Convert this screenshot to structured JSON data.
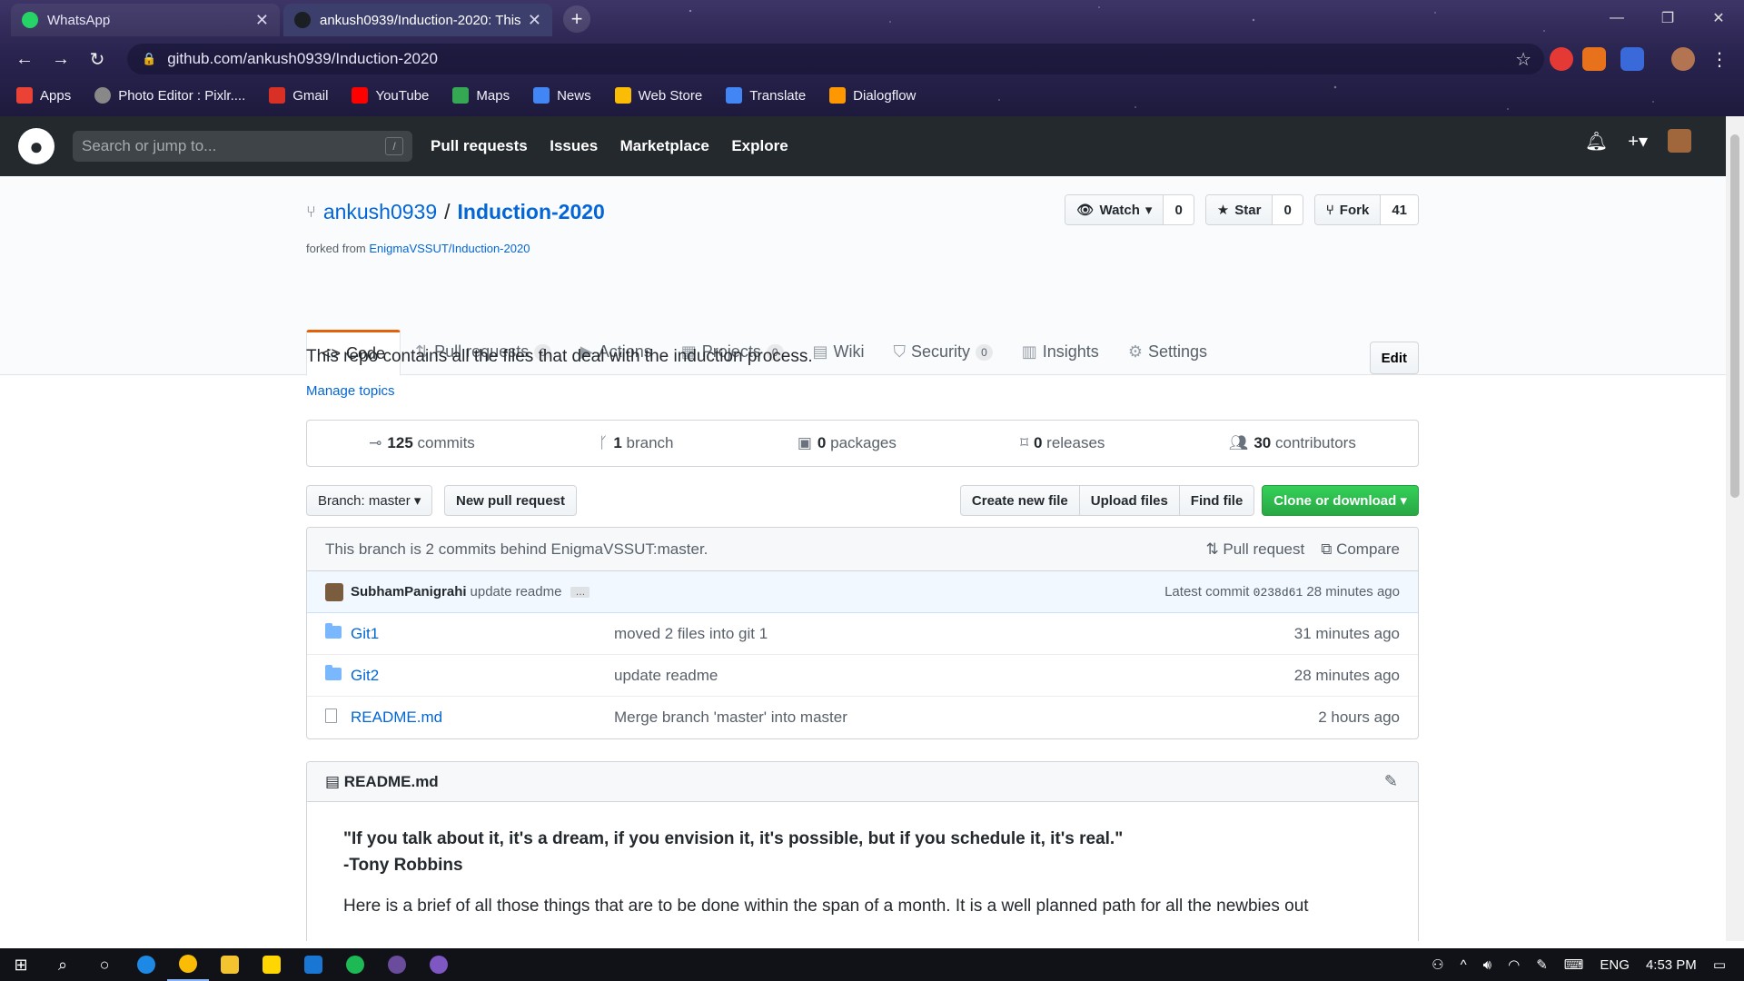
{
  "browser": {
    "tabs": [
      {
        "title": "WhatsApp",
        "active": false,
        "favicon_color": "#25d366"
      },
      {
        "title": "ankush0939/Induction-2020: This",
        "active": true,
        "favicon_color": "#1b1f23"
      }
    ],
    "url": "github.com/ankush0939/Induction-2020",
    "bookmarks": [
      {
        "label": "Apps",
        "icon": "apps-grid-icon",
        "color": "#ea4335"
      },
      {
        "label": "Photo Editor : Pixlr....",
        "icon": "pixlr-icon",
        "color": "#888888"
      },
      {
        "label": "Gmail",
        "icon": "gmail-icon",
        "color": "#d93025"
      },
      {
        "label": "YouTube",
        "icon": "youtube-icon",
        "color": "#ff0000"
      },
      {
        "label": "Maps",
        "icon": "maps-icon",
        "color": "#34a853"
      },
      {
        "label": "News",
        "icon": "news-icon",
        "color": "#4285f4"
      },
      {
        "label": "Web Store",
        "icon": "webstore-icon",
        "color": "#fbbc05"
      },
      {
        "label": "Translate",
        "icon": "translate-icon",
        "color": "#4285f4"
      },
      {
        "label": "Dialogflow",
        "icon": "dialogflow-icon",
        "color": "#ff9800"
      }
    ]
  },
  "github": {
    "search_placeholder": "Search or jump to...",
    "search_key": "/",
    "nav": [
      "Pull requests",
      "Issues",
      "Marketplace",
      "Explore"
    ]
  },
  "repo": {
    "owner": "ankush0939",
    "name": "Induction-2020",
    "forked_prefix": "forked from",
    "forked_from": "EnigmaVSSUT/Induction-2020",
    "watch": {
      "label": "Watch",
      "count": "0"
    },
    "star": {
      "label": "Star",
      "count": "0"
    },
    "fork": {
      "label": "Fork",
      "count": "41"
    },
    "tabs": [
      {
        "label": "Code",
        "counter": "",
        "icon": "code-icon"
      },
      {
        "label": "Pull requests",
        "counter": "0",
        "icon": "pull-request-icon"
      },
      {
        "label": "Actions",
        "counter": "",
        "icon": "play-icon"
      },
      {
        "label": "Projects",
        "counter": "0",
        "icon": "project-icon"
      },
      {
        "label": "Wiki",
        "counter": "",
        "icon": "book-icon"
      },
      {
        "label": "Security",
        "counter": "0",
        "icon": "shield-icon"
      },
      {
        "label": "Insights",
        "counter": "",
        "icon": "graph-icon"
      },
      {
        "label": "Settings",
        "counter": "",
        "icon": "gear-icon"
      }
    ],
    "description": "This repo contains all the files that deal with the induction process.",
    "edit_label": "Edit",
    "manage_topics": "Manage topics",
    "stats": [
      {
        "count": "125",
        "label": "commits",
        "icon": "commit-icon"
      },
      {
        "count": "1",
        "label": "branch",
        "icon": "branch-icon"
      },
      {
        "count": "0",
        "label": "packages",
        "icon": "package-icon"
      },
      {
        "count": "0",
        "label": "releases",
        "icon": "tag-icon"
      },
      {
        "count": "30",
        "label": "contributors",
        "icon": "people-icon"
      }
    ],
    "branch_button": "Branch: master",
    "new_pr": "New pull request",
    "create_file": "Create new file",
    "upload_files": "Upload files",
    "find_file": "Find file",
    "clone": "Clone or download",
    "branch_status": "This branch is 2 commits behind EnigmaVSSUT:master.",
    "pull_request_link": "Pull request",
    "compare_link": "Compare",
    "latest_commit": {
      "author": "SubhamPanigrahi",
      "message": "update readme",
      "ellipsis": "…",
      "label": "Latest commit",
      "sha": "0238d61",
      "age": "28 minutes ago"
    },
    "files": [
      {
        "type": "dir",
        "name": "Git1",
        "message": "moved 2 files into git 1",
        "age": "31 minutes ago"
      },
      {
        "type": "dir",
        "name": "Git2",
        "message": "update readme",
        "age": "28 minutes ago"
      },
      {
        "type": "file",
        "name": "README.md",
        "message": "Merge branch 'master' into master",
        "age": "2 hours ago"
      }
    ],
    "readme": {
      "title": "README.md",
      "quote": "\"If you talk about it, it's a dream, if you envision it, it's possible, but if you schedule it, it's real.\"",
      "attribution": "-Tony Robbins",
      "intro": "Here is a brief of all those things that are to be done within the span of a month. It is a well planned path for all the newbies out"
    }
  },
  "taskbar": {
    "language": "ENG",
    "time": "4:53 PM"
  }
}
